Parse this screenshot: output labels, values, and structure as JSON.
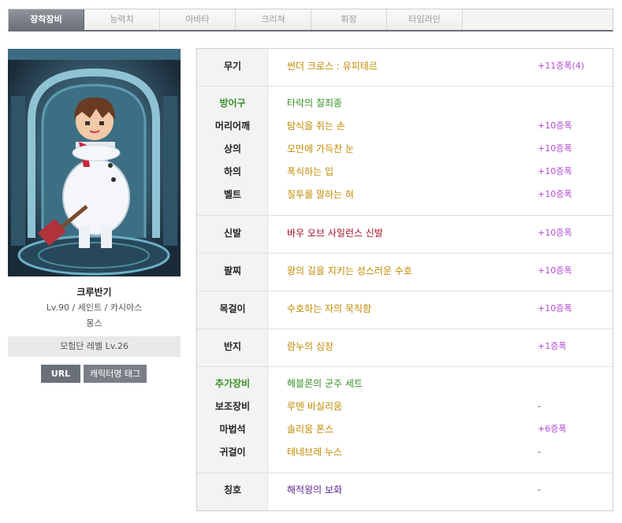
{
  "tabs": [
    {
      "label": "장착장비",
      "active": true
    },
    {
      "label": "능력치",
      "active": false
    },
    {
      "label": "아바타",
      "active": false
    },
    {
      "label": "크리쳐",
      "active": false
    },
    {
      "label": "휘장",
      "active": false
    },
    {
      "label": "타임라인",
      "active": false
    }
  ],
  "character": {
    "name": "크루반기",
    "info": "Lv.90 / 세인트 / 카시야스",
    "guild": "몽스",
    "adventure_level": "모험단 레벨 Lv.26"
  },
  "buttons": {
    "url": "URL",
    "tag": "캐릭터명 태그"
  },
  "equipment": {
    "weapon": {
      "label": "무기",
      "item": "썬더 크로스 : 유피테르",
      "enhance": "+11증폭(4)"
    },
    "armor_header": {
      "label": "방어구",
      "item": "타락의 칠죄종"
    },
    "shoulder": {
      "label": "머리어깨",
      "item": "탐식을 쥐는 손",
      "enhance": "+10증폭"
    },
    "top": {
      "label": "상의",
      "item": "오만에 가득찬 눈",
      "enhance": "+10증폭"
    },
    "bottom": {
      "label": "하의",
      "item": "폭식하는 입",
      "enhance": "+10증폭"
    },
    "belt": {
      "label": "벨트",
      "item": "질투를 말하는 혀",
      "enhance": "+10증폭"
    },
    "shoes": {
      "label": "신발",
      "item": "바우 오브 사일런스 신발",
      "enhance": "+10증폭"
    },
    "bracelet": {
      "label": "팔찌",
      "item": "왕의 길을 지키는 성스러운 수호",
      "enhance": "+10증폭"
    },
    "necklace": {
      "label": "목걸이",
      "item": "수호하는 자의 묵직함",
      "enhance": "+10증폭"
    },
    "ring": {
      "label": "반지",
      "item": "람누의 심장",
      "enhance": "+1증폭"
    },
    "extra_header": {
      "label": "추가장비",
      "item": "헤블론의 군주 세트"
    },
    "sub": {
      "label": "보조장비",
      "item": "루멘 바실리움",
      "enhance": "-"
    },
    "magic_stone": {
      "label": "마법석",
      "item": "솔리움 폰스",
      "enhance": "+6증폭"
    },
    "earring": {
      "label": "귀걸이",
      "item": "테네브레 누스",
      "enhance": "-"
    },
    "title": {
      "label": "칭호",
      "item": "해적왕의 보화",
      "enhance": "-"
    }
  },
  "colors": {
    "tab_active": "#6a7079",
    "label_green": "#3a8f2a",
    "item_gold": "#c08a00",
    "item_red": "#a3102a",
    "item_purple": "#5b2a8e",
    "enhance": "#b24bd0"
  }
}
